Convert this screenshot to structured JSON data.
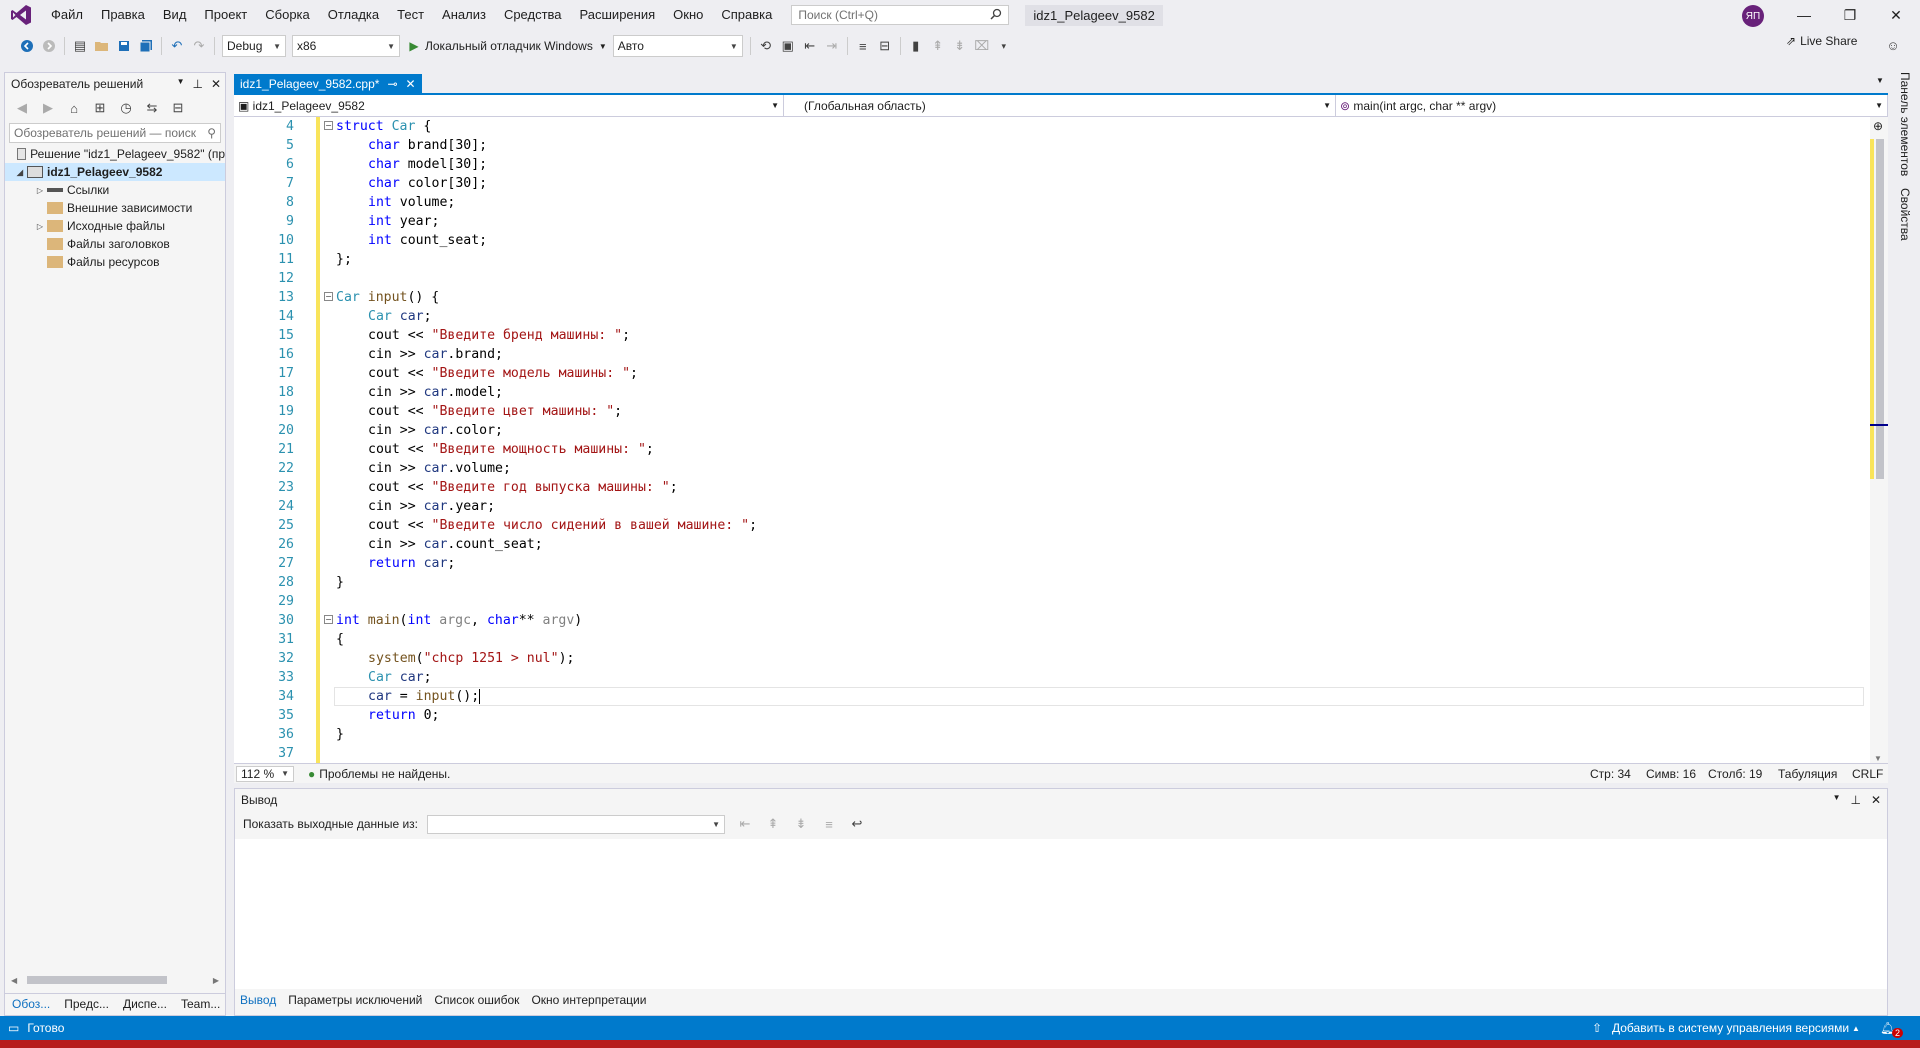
{
  "window": {
    "solution_title": "idz1_Pelageev_9582",
    "avatar": "ЯП",
    "minimize": "—",
    "restore": "❐",
    "close": "✕"
  },
  "menu": [
    "Файл",
    "Правка",
    "Вид",
    "Проект",
    "Сборка",
    "Отладка",
    "Тест",
    "Анализ",
    "Средства",
    "Расширения",
    "Окно",
    "Справка"
  ],
  "search": {
    "placeholder": "Поиск (Ctrl+Q)"
  },
  "toolbar": {
    "config": "Debug",
    "platform": "x86",
    "debugger": "Локальный отладчик Windows",
    "auto": "Авто",
    "live_share": "Live Share"
  },
  "solution_explorer": {
    "title": "Обозреватель решений",
    "search_placeholder": "Обозреватель решений — поиск",
    "solution": "Решение \"idz1_Pelageev_9582\" (пр",
    "project": "idz1_Pelageev_9582",
    "items": [
      "Ссылки",
      "Внешние зависимости",
      "Исходные файлы",
      "Файлы заголовков",
      "Файлы ресурсов"
    ],
    "tabs": [
      "Обоз...",
      "Предс...",
      "Диспе...",
      "Team..."
    ]
  },
  "editor": {
    "tab": "idz1_Pelageev_9582.cpp*",
    "nav_project": "idz1_Pelageev_9582",
    "nav_scope": "(Глобальная область)",
    "nav_member": "main(int argc, char ** argv)",
    "zoom": "112 %",
    "issues": "Проблемы не найдены.",
    "line": "Стр: 34",
    "char": "Симв: 16",
    "col": "Столб: 19",
    "tabs_mode": "Табуляция",
    "eol": "CRLF"
  },
  "code_lines": [
    {
      "n": "4"
    },
    {
      "n": "5"
    },
    {
      "n": "6"
    },
    {
      "n": "7"
    },
    {
      "n": "8"
    },
    {
      "n": "9"
    },
    {
      "n": "10"
    },
    {
      "n": "11"
    },
    {
      "n": "12"
    },
    {
      "n": "13"
    },
    {
      "n": "14"
    },
    {
      "n": "15"
    },
    {
      "n": "16"
    },
    {
      "n": "17"
    },
    {
      "n": "18"
    },
    {
      "n": "19"
    },
    {
      "n": "20"
    },
    {
      "n": "21"
    },
    {
      "n": "22"
    },
    {
      "n": "23"
    },
    {
      "n": "24"
    },
    {
      "n": "25"
    },
    {
      "n": "26"
    },
    {
      "n": "27"
    },
    {
      "n": "28"
    },
    {
      "n": "29"
    },
    {
      "n": "30"
    },
    {
      "n": "31"
    },
    {
      "n": "32"
    },
    {
      "n": "33"
    },
    {
      "n": "34"
    },
    {
      "n": "35"
    },
    {
      "n": "36"
    },
    {
      "n": "37"
    }
  ],
  "code_text": {
    "l4": [
      "struct",
      " ",
      "Car",
      " {"
    ],
    "l5": [
      "char",
      " brand[30];"
    ],
    "l6": [
      "char",
      " model[30];"
    ],
    "l7": [
      "char",
      " color[30];"
    ],
    "l8": [
      "int",
      " volume;"
    ],
    "l9": [
      "int",
      " year;"
    ],
    "l10": [
      "int",
      " count_seat;"
    ],
    "l11": "};",
    "l13": [
      "Car",
      " ",
      "input",
      "() {"
    ],
    "l14": [
      "Car",
      " ",
      "car",
      ";"
    ],
    "l15": [
      "cout << ",
      "\"Введите бренд машины: \"",
      ";"
    ],
    "l16": [
      "cin >> ",
      "car",
      ".brand;"
    ],
    "l17": [
      "cout << ",
      "\"Введите модель машины: \"",
      ";"
    ],
    "l18": [
      "cin >> ",
      "car",
      ".model;"
    ],
    "l19": [
      "cout << ",
      "\"Введите цвет машины: \"",
      ";"
    ],
    "l20": [
      "cin >> ",
      "car",
      ".color;"
    ],
    "l21": [
      "cout << ",
      "\"Введите мощность машины: \"",
      ";"
    ],
    "l22": [
      "cin >> ",
      "car",
      ".volume;"
    ],
    "l23": [
      "cout << ",
      "\"Введите год выпуска машины: \"",
      ";"
    ],
    "l24": [
      "cin >> ",
      "car",
      ".year;"
    ],
    "l25": [
      "cout << ",
      "\"Введите число сидений в вашей машине: \"",
      ";"
    ],
    "l26": [
      "cin >> ",
      "car",
      ".count_seat;"
    ],
    "l27": [
      "return",
      " ",
      "car",
      ";"
    ],
    "l28": "}",
    "l30": [
      "int",
      " ",
      "main",
      "(",
      "int",
      " ",
      "argc",
      ", ",
      "char",
      "** ",
      "argv",
      ")"
    ],
    "l31": "{",
    "l32": [
      "system",
      "(",
      "\"chcp 1251 > nul\"",
      ");"
    ],
    "l33": [
      "Car",
      " ",
      "car",
      ";"
    ],
    "l34": [
      "car",
      " = ",
      "input",
      "();"
    ],
    "l35": [
      "return",
      " 0;"
    ],
    "l36": "}"
  },
  "output": {
    "title": "Вывод",
    "show_from": "Показать выходные данные из:",
    "tabs": [
      "Вывод",
      "Параметры исключений",
      "Список ошибок",
      "Окно интерпретации"
    ]
  },
  "right_rail": [
    "Панель элементов",
    "Свойства"
  ],
  "status": {
    "ready": "Готово",
    "vcs": "Добавить в систему управления версиями",
    "badge": "2"
  }
}
